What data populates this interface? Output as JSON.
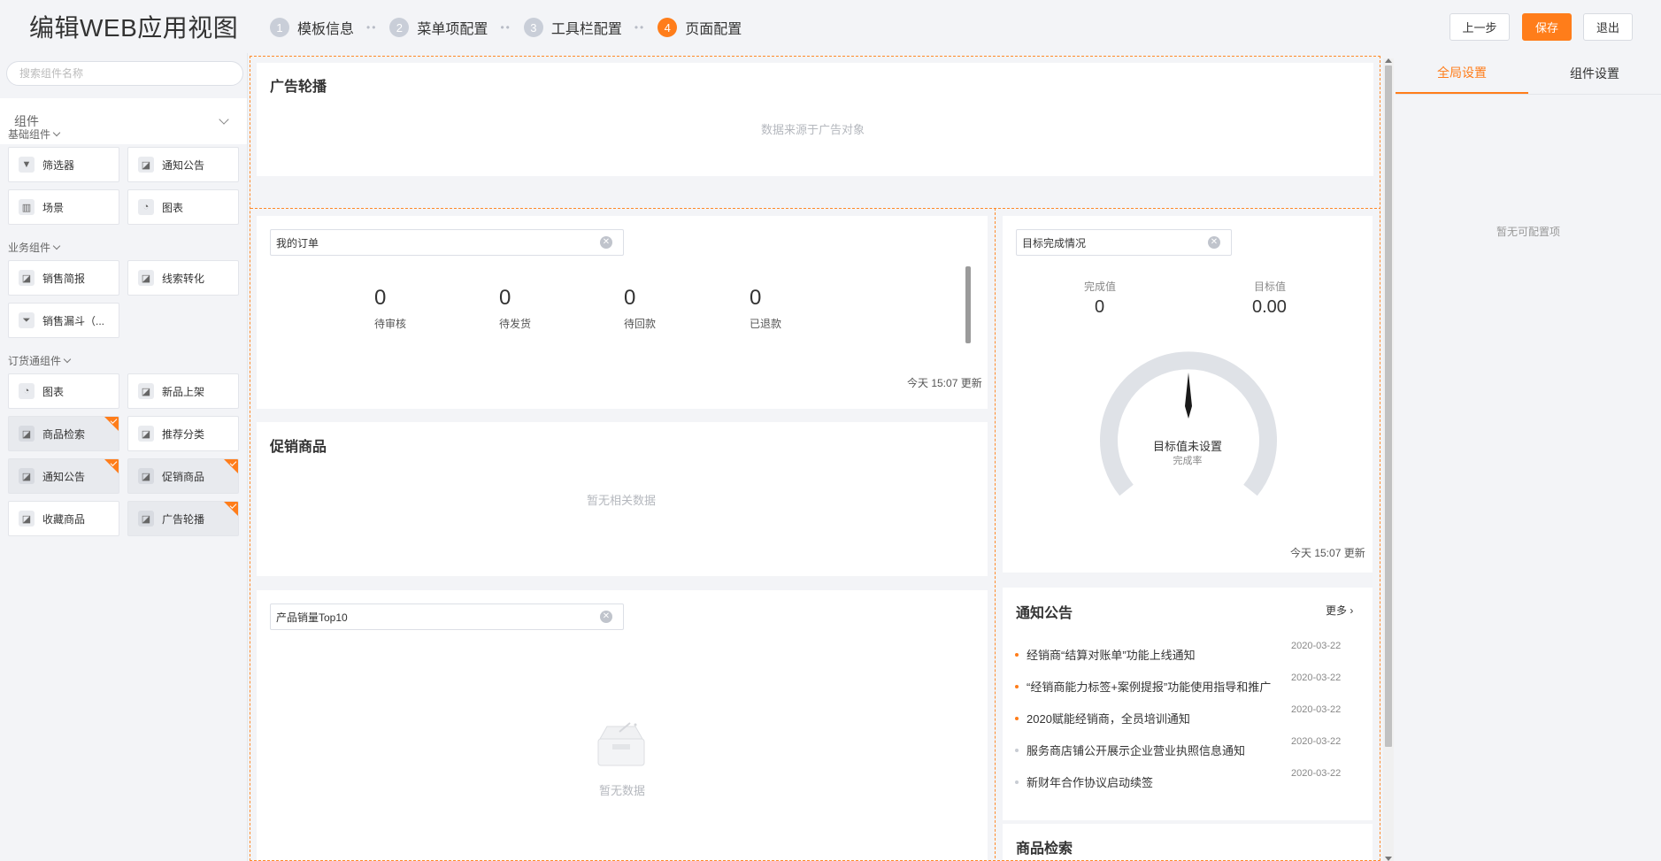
{
  "header": {
    "title": "编辑WEB应用视图",
    "steps": [
      {
        "num": "1",
        "label": "模板信息"
      },
      {
        "num": "2",
        "label": "菜单项配置"
      },
      {
        "num": "3",
        "label": "工具栏配置"
      },
      {
        "num": "4",
        "label": "页面配置"
      }
    ],
    "prev_label": "上一步",
    "save_label": "保存",
    "exit_label": "退出",
    "accent_color": "#ff7d1a"
  },
  "left": {
    "search_placeholder": "搜索组件名称",
    "dropdown_label": "组件",
    "groups": [
      {
        "title": "基础组件",
        "items": [
          {
            "label": "筛选器",
            "icon": "filter-icon"
          },
          {
            "label": "通知公告",
            "icon": "component-icon"
          },
          {
            "label": "场景",
            "icon": "layout-icon"
          },
          {
            "label": "图表",
            "icon": "pie-chart-icon"
          }
        ]
      },
      {
        "title": "业务组件",
        "items": [
          {
            "label": "销售简报",
            "icon": "component-icon"
          },
          {
            "label": "线索转化",
            "icon": "component-icon"
          },
          {
            "label": "销售漏斗（...",
            "icon": "funnel-icon"
          }
        ]
      },
      {
        "title": "订货通组件",
        "items": [
          {
            "label": "图表",
            "icon": "pie-chart-icon"
          },
          {
            "label": "新品上架",
            "icon": "component-icon"
          },
          {
            "label": "商品检索",
            "icon": "component-icon",
            "used": true
          },
          {
            "label": "推荐分类",
            "icon": "component-icon"
          },
          {
            "label": "通知公告",
            "icon": "component-icon",
            "used": true
          },
          {
            "label": "促销商品",
            "icon": "component-icon",
            "used": true
          },
          {
            "label": "收藏商品",
            "icon": "component-icon"
          },
          {
            "label": "广告轮播",
            "icon": "component-icon",
            "used": true
          }
        ]
      }
    ]
  },
  "canvas": {
    "banner": {
      "title": "广告轮播",
      "note": "数据来源于广告对象"
    },
    "orders": {
      "select_value": "我的订单",
      "stats": [
        {
          "value": "0",
          "label": "待审核"
        },
        {
          "value": "0",
          "label": "待发货"
        },
        {
          "value": "0",
          "label": "待回款"
        },
        {
          "value": "0",
          "label": "已退款"
        }
      ],
      "updated": "今天 15:07 更新"
    },
    "promo": {
      "title": "促销商品",
      "empty": "暂无相关数据"
    },
    "top10": {
      "select_value": "产品销量Top10",
      "empty": "暂无数据"
    },
    "goal": {
      "select_value": "目标完成情况",
      "done_label": "完成值",
      "done_value": "0",
      "target_label": "目标值",
      "target_value": "0.00",
      "gauge_main": "目标值未设置",
      "gauge_sub": "完成率",
      "gauge_fraction": 0,
      "updated": "今天 15:07 更新"
    },
    "notice": {
      "title": "通知公告",
      "more": "更多",
      "items": [
        {
          "text": "经销商“结算对账单”功能上线通知",
          "date": "2020-03-22",
          "highlight": true
        },
        {
          "text": "“经销商能力标签+案例提报”功能使用指导和推广",
          "date": "2020-03-22",
          "highlight": true
        },
        {
          "text": "2020赋能经销商，全员培训通知",
          "date": "2020-03-22",
          "highlight": true
        },
        {
          "text": "服务商店铺公开展示企业营业执照信息通知",
          "date": "2020-03-22",
          "highlight": false
        },
        {
          "text": "新财年合作协议启动续签",
          "date": "2020-03-22",
          "highlight": false
        }
      ]
    },
    "search_card": {
      "title": "商品检索"
    }
  },
  "right": {
    "tabs": [
      {
        "label": "全局设置",
        "active": true
      },
      {
        "label": "组件设置",
        "active": false
      }
    ],
    "empty": "暂无可配置项"
  }
}
